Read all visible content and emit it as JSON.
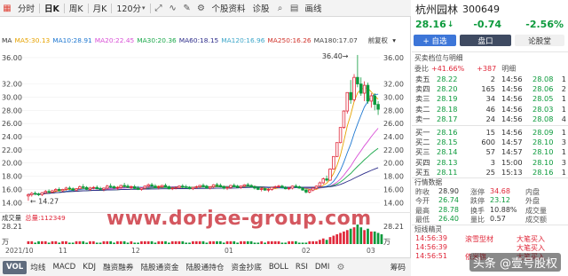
{
  "toolbar": {
    "items": [
      {
        "label": "分时",
        "active": false
      },
      {
        "label": "日K",
        "active": true
      },
      {
        "label": "周K",
        "active": false
      },
      {
        "label": "月K",
        "active": false
      },
      {
        "label": "120分",
        "active": false
      }
    ],
    "extra": [
      "个股资料",
      "诊股",
      "画线"
    ],
    "icons": [
      "layout-icon",
      "fullscreen-icon",
      "line-chart-icon",
      "draw-icon",
      "settings-icon",
      "search-icon",
      "grid-icon"
    ]
  },
  "ma_row": {
    "title": "MA",
    "items": [
      {
        "label": "MA5:30.13",
        "color": "#e6a200"
      },
      {
        "label": "MA10:28.91",
        "color": "#1f78d1"
      },
      {
        "label": "MA20:22.45",
        "color": "#d84fd6"
      },
      {
        "label": "MA30:20.36",
        "color": "#1aa84a"
      },
      {
        "label": "MA60:18.15",
        "color": "#2d2d8a"
      },
      {
        "label": "MA120:16.96",
        "color": "#3da6c9"
      },
      {
        "label": "MA250:16.26",
        "color": "#d0332b"
      },
      {
        "label": "MA180:17.07",
        "color": "#444444"
      }
    ],
    "fq": "前复权"
  },
  "chart_data": {
    "type": "candlestick",
    "y_ticks": [
      "36.00",
      "32.00",
      "30.00",
      "28.00",
      "26.00",
      "24.00",
      "22.00",
      "20.00",
      "18.00",
      "16.00",
      "14.00"
    ],
    "ylim": [
      13.5,
      37.2
    ],
    "high_label": "36.40",
    "low_label": "14.27",
    "dates": [
      "2021/10",
      "11",
      "12",
      "01",
      "02",
      "03"
    ],
    "candles": [
      {
        "o": 15.0,
        "h": 15.4,
        "l": 14.27,
        "c": 15.2
      },
      {
        "o": 15.2,
        "h": 15.6,
        "l": 14.9,
        "c": 15.4
      },
      {
        "o": 15.4,
        "h": 15.7,
        "l": 15.1,
        "c": 15.3
      },
      {
        "o": 15.3,
        "h": 15.5,
        "l": 15.0,
        "c": 15.2
      },
      {
        "o": 15.2,
        "h": 15.6,
        "l": 15.0,
        "c": 15.5
      },
      {
        "o": 15.5,
        "h": 15.9,
        "l": 15.3,
        "c": 15.7
      },
      {
        "o": 15.7,
        "h": 16.0,
        "l": 15.5,
        "c": 15.6
      },
      {
        "o": 15.6,
        "h": 15.9,
        "l": 15.4,
        "c": 15.8
      },
      {
        "o": 15.8,
        "h": 16.2,
        "l": 15.6,
        "c": 16.0
      },
      {
        "o": 16.0,
        "h": 16.3,
        "l": 15.7,
        "c": 15.8
      },
      {
        "o": 15.8,
        "h": 16.1,
        "l": 15.6,
        "c": 16.0
      },
      {
        "o": 16.0,
        "h": 16.4,
        "l": 15.8,
        "c": 16.2
      },
      {
        "o": 16.2,
        "h": 16.5,
        "l": 15.9,
        "c": 16.1
      },
      {
        "o": 16.1,
        "h": 16.3,
        "l": 15.8,
        "c": 15.9
      },
      {
        "o": 15.9,
        "h": 16.2,
        "l": 15.7,
        "c": 16.1
      },
      {
        "o": 16.1,
        "h": 16.6,
        "l": 16.0,
        "c": 16.4
      },
      {
        "o": 16.4,
        "h": 16.8,
        "l": 16.1,
        "c": 16.3
      },
      {
        "o": 16.3,
        "h": 16.5,
        "l": 15.9,
        "c": 16.0
      },
      {
        "o": 16.0,
        "h": 16.4,
        "l": 15.8,
        "c": 16.2
      },
      {
        "o": 16.2,
        "h": 16.5,
        "l": 16.0,
        "c": 16.3
      },
      {
        "o": 16.3,
        "h": 16.6,
        "l": 16.0,
        "c": 16.1
      },
      {
        "o": 16.1,
        "h": 16.4,
        "l": 15.8,
        "c": 16.0
      },
      {
        "o": 16.0,
        "h": 16.3,
        "l": 15.7,
        "c": 16.2
      },
      {
        "o": 16.2,
        "h": 16.7,
        "l": 16.0,
        "c": 16.5
      },
      {
        "o": 16.5,
        "h": 16.9,
        "l": 16.2,
        "c": 16.4
      },
      {
        "o": 16.4,
        "h": 16.6,
        "l": 16.1,
        "c": 16.2
      },
      {
        "o": 16.2,
        "h": 16.5,
        "l": 15.9,
        "c": 16.3
      },
      {
        "o": 16.3,
        "h": 16.7,
        "l": 16.1,
        "c": 16.6
      },
      {
        "o": 16.6,
        "h": 17.0,
        "l": 16.3,
        "c": 16.5
      },
      {
        "o": 16.5,
        "h": 16.8,
        "l": 16.2,
        "c": 16.3
      },
      {
        "o": 16.3,
        "h": 16.6,
        "l": 16.0,
        "c": 16.4
      },
      {
        "o": 16.4,
        "h": 16.7,
        "l": 16.1,
        "c": 16.2
      },
      {
        "o": 16.2,
        "h": 16.5,
        "l": 15.9,
        "c": 16.0
      },
      {
        "o": 16.0,
        "h": 16.3,
        "l": 15.8,
        "c": 16.2
      },
      {
        "o": 16.2,
        "h": 16.6,
        "l": 16.0,
        "c": 16.5
      },
      {
        "o": 16.5,
        "h": 16.9,
        "l": 16.3,
        "c": 16.7
      },
      {
        "o": 16.7,
        "h": 17.0,
        "l": 16.4,
        "c": 16.5
      },
      {
        "o": 16.5,
        "h": 16.8,
        "l": 16.2,
        "c": 16.3
      },
      {
        "o": 16.3,
        "h": 16.6,
        "l": 16.0,
        "c": 16.4
      },
      {
        "o": 16.4,
        "h": 16.7,
        "l": 16.2,
        "c": 16.6
      },
      {
        "o": 16.6,
        "h": 16.9,
        "l": 16.3,
        "c": 16.4
      },
      {
        "o": 16.4,
        "h": 16.6,
        "l": 16.0,
        "c": 16.1
      },
      {
        "o": 16.1,
        "h": 16.4,
        "l": 15.9,
        "c": 16.2
      },
      {
        "o": 16.2,
        "h": 16.5,
        "l": 16.0,
        "c": 16.3
      },
      {
        "o": 16.3,
        "h": 16.6,
        "l": 16.1,
        "c": 16.5
      },
      {
        "o": 16.5,
        "h": 16.8,
        "l": 16.2,
        "c": 16.4
      },
      {
        "o": 16.4,
        "h": 16.7,
        "l": 16.1,
        "c": 16.3
      },
      {
        "o": 16.3,
        "h": 16.5,
        "l": 16.0,
        "c": 16.1
      },
      {
        "o": 16.1,
        "h": 16.4,
        "l": 15.9,
        "c": 16.3
      },
      {
        "o": 16.3,
        "h": 16.6,
        "l": 16.1,
        "c": 16.4
      },
      {
        "o": 16.4,
        "h": 16.7,
        "l": 16.2,
        "c": 16.6
      },
      {
        "o": 16.6,
        "h": 16.9,
        "l": 16.3,
        "c": 16.5
      },
      {
        "o": 16.5,
        "h": 16.7,
        "l": 16.1,
        "c": 16.2
      },
      {
        "o": 16.2,
        "h": 16.5,
        "l": 16.0,
        "c": 16.4
      },
      {
        "o": 16.4,
        "h": 16.8,
        "l": 16.2,
        "c": 16.7
      },
      {
        "o": 16.7,
        "h": 17.0,
        "l": 16.4,
        "c": 16.6
      },
      {
        "o": 16.6,
        "h": 16.9,
        "l": 16.3,
        "c": 16.4
      },
      {
        "o": 16.4,
        "h": 16.6,
        "l": 16.0,
        "c": 16.2
      },
      {
        "o": 16.2,
        "h": 16.5,
        "l": 15.9,
        "c": 16.3
      },
      {
        "o": 16.3,
        "h": 16.7,
        "l": 16.1,
        "c": 16.6
      },
      {
        "o": 16.6,
        "h": 16.9,
        "l": 16.4,
        "c": 16.5
      },
      {
        "o": 16.5,
        "h": 16.7,
        "l": 16.2,
        "c": 16.3
      },
      {
        "o": 16.3,
        "h": 16.6,
        "l": 16.1,
        "c": 16.5
      },
      {
        "o": 16.5,
        "h": 16.8,
        "l": 16.3,
        "c": 16.7
      },
      {
        "o": 16.7,
        "h": 17.0,
        "l": 16.5,
        "c": 16.6
      },
      {
        "o": 16.6,
        "h": 16.8,
        "l": 16.3,
        "c": 16.4
      },
      {
        "o": 16.4,
        "h": 16.6,
        "l": 16.0,
        "c": 16.2
      },
      {
        "o": 16.2,
        "h": 16.4,
        "l": 15.9,
        "c": 16.0
      },
      {
        "o": 16.0,
        "h": 16.3,
        "l": 15.7,
        "c": 16.1
      },
      {
        "o": 16.1,
        "h": 16.3,
        "l": 15.8,
        "c": 15.9
      },
      {
        "o": 15.9,
        "h": 16.2,
        "l": 15.6,
        "c": 16.0
      },
      {
        "o": 16.0,
        "h": 16.4,
        "l": 15.8,
        "c": 16.3
      },
      {
        "o": 16.3,
        "h": 16.6,
        "l": 16.1,
        "c": 16.4
      },
      {
        "o": 16.4,
        "h": 16.7,
        "l": 16.2,
        "c": 16.5
      },
      {
        "o": 16.5,
        "h": 16.7,
        "l": 16.2,
        "c": 16.3
      },
      {
        "o": 16.3,
        "h": 16.5,
        "l": 16.0,
        "c": 16.1
      },
      {
        "o": 16.1,
        "h": 16.4,
        "l": 15.9,
        "c": 16.2
      },
      {
        "o": 16.2,
        "h": 16.6,
        "l": 16.0,
        "c": 16.5
      },
      {
        "o": 16.5,
        "h": 16.8,
        "l": 16.2,
        "c": 16.4
      },
      {
        "o": 16.4,
        "h": 16.6,
        "l": 16.1,
        "c": 16.2
      },
      {
        "o": 16.2,
        "h": 16.4,
        "l": 15.8,
        "c": 15.9
      },
      {
        "o": 15.9,
        "h": 16.1,
        "l": 15.4,
        "c": 15.6
      },
      {
        "o": 15.6,
        "h": 16.0,
        "l": 15.4,
        "c": 15.9
      },
      {
        "o": 15.9,
        "h": 16.3,
        "l": 15.7,
        "c": 16.2
      },
      {
        "o": 16.2,
        "h": 16.6,
        "l": 16.0,
        "c": 16.5
      },
      {
        "o": 16.5,
        "h": 17.2,
        "l": 16.4,
        "c": 17.0
      },
      {
        "o": 17.0,
        "h": 17.8,
        "l": 16.8,
        "c": 17.6
      },
      {
        "o": 17.6,
        "h": 18.1,
        "l": 17.2,
        "c": 17.4
      },
      {
        "o": 17.4,
        "h": 19.2,
        "l": 17.3,
        "c": 19.1
      },
      {
        "o": 19.1,
        "h": 21.0,
        "l": 19.0,
        "c": 21.0
      },
      {
        "o": 21.0,
        "h": 23.1,
        "l": 20.9,
        "c": 23.1
      },
      {
        "o": 23.1,
        "h": 25.4,
        "l": 23.0,
        "c": 25.4
      },
      {
        "o": 25.4,
        "h": 28.0,
        "l": 25.2,
        "c": 27.9
      },
      {
        "o": 27.9,
        "h": 30.7,
        "l": 27.5,
        "c": 30.7
      },
      {
        "o": 30.7,
        "h": 32.6,
        "l": 29.0,
        "c": 29.6
      },
      {
        "o": 29.6,
        "h": 33.5,
        "l": 29.3,
        "c": 33.0
      },
      {
        "o": 33.0,
        "h": 36.4,
        "l": 31.5,
        "c": 32.0
      },
      {
        "o": 32.0,
        "h": 33.0,
        "l": 30.2,
        "c": 30.6
      },
      {
        "o": 30.6,
        "h": 32.4,
        "l": 29.4,
        "c": 31.8
      },
      {
        "o": 31.8,
        "h": 32.2,
        "l": 29.0,
        "c": 29.4
      },
      {
        "o": 29.4,
        "h": 30.6,
        "l": 28.4,
        "c": 30.2
      },
      {
        "o": 30.2,
        "h": 30.6,
        "l": 28.0,
        "c": 28.9
      },
      {
        "o": 28.9,
        "h": 29.4,
        "l": 27.3,
        "c": 28.16
      }
    ],
    "volume_title": "成交量",
    "volume_total": "总量:112349",
    "volume_axis": "28.21",
    "volume_unit": "万",
    "volumes": [
      2,
      2,
      1,
      2,
      2,
      2,
      1,
      2,
      2,
      1,
      2,
      2,
      1,
      1,
      2,
      2,
      2,
      1,
      2,
      2,
      1,
      1,
      2,
      2,
      2,
      1,
      2,
      2,
      2,
      1,
      2,
      1,
      1,
      2,
      2,
      2,
      2,
      1,
      2,
      2,
      2,
      1,
      2,
      2,
      2,
      2,
      1,
      1,
      2,
      2,
      2,
      2,
      1,
      2,
      2,
      2,
      2,
      1,
      2,
      2,
      2,
      1,
      2,
      2,
      2,
      2,
      1,
      1,
      2,
      1,
      2,
      2,
      2,
      2,
      1,
      1,
      2,
      2,
      2,
      1,
      1,
      1,
      2,
      2,
      2,
      3,
      4,
      3,
      5,
      6,
      7,
      8,
      9,
      10,
      11,
      12,
      14,
      12,
      10,
      11,
      9,
      9,
      8,
      7
    ]
  },
  "indicators": {
    "items": [
      "VOL",
      "均线",
      "MACD",
      "KDJ",
      "融资融券",
      "陆股通资金",
      "陆股通持仓",
      "资金抄底",
      "BOLL",
      "RSI",
      "DMI"
    ],
    "active": "VOL",
    "chip": "筹码"
  },
  "watermark": "www.dorjee-group.com",
  "quote": {
    "name": "杭州园林",
    "code": "300649",
    "price": "28.16",
    "arrow": "↓",
    "change": "-0.74",
    "pct": "-2.56%",
    "add_label": "+ 自选",
    "pankou_label": "盘口",
    "lunguge_label": "论股堂",
    "wb_title": "买卖档位与明细",
    "wb_label": "委比",
    "wb_pct": "+41.66%",
    "wb_diff": "+387",
    "detail_label": "明细",
    "asks": [
      {
        "name": "卖五",
        "price": "28.22",
        "vol": "2",
        "t": "14:56",
        "tp": "28.08",
        "tv": "1"
      },
      {
        "name": "卖四",
        "price": "28.20",
        "vol": "165",
        "t": "14:56",
        "tp": "28.06",
        "tv": "2"
      },
      {
        "name": "卖三",
        "price": "28.19",
        "vol": "34",
        "t": "14:56",
        "tp": "28.05",
        "tv": "1"
      },
      {
        "name": "卖二",
        "price": "28.18",
        "vol": "46",
        "t": "14:56",
        "tp": "28.03",
        "tv": "1"
      },
      {
        "name": "卖一",
        "price": "28.17",
        "vol": "24",
        "t": "14:56",
        "tp": "28.08",
        "tv": "4"
      }
    ],
    "bids": [
      {
        "name": "买一",
        "price": "28.16",
        "vol": "15",
        "t": "14:56",
        "tp": "28.09",
        "tv": "1"
      },
      {
        "name": "买二",
        "price": "28.15",
        "vol": "600",
        "t": "14:57",
        "tp": "28.10",
        "tv": "3"
      },
      {
        "name": "买三",
        "price": "28.14",
        "vol": "57",
        "t": "14:57",
        "tp": "28.10",
        "tv": "1"
      },
      {
        "name": "买四",
        "price": "28.13",
        "vol": "3",
        "t": "15:00",
        "tp": "28.10",
        "tv": "3"
      },
      {
        "name": "买五",
        "price": "28.11",
        "vol": "25",
        "t": "15:13",
        "tp": "28.16",
        "tv": "1"
      }
    ],
    "stats_title": "行情数据",
    "stats": [
      {
        "l1": "昨收",
        "v1": "28.90",
        "l2": "涨停",
        "v2": "34.68",
        "l3": "内盘"
      },
      {
        "l1": "今开",
        "v1": "26.74",
        "l2": "跌停",
        "v2": "23.12",
        "l3": "外盘"
      },
      {
        "l1": "最高",
        "v1": "28.78",
        "l2": "换手",
        "v2": "10.88%",
        "l3": "成交量"
      },
      {
        "l1": "最低",
        "v1": "26.40",
        "l2": "量比",
        "v2": "0.57",
        "l3": "成交额"
      }
    ],
    "ticks_title": "短线精灵",
    "ticks": [
      {
        "t": "14:56:39",
        "tag": "滚雪型材",
        "act": "大笔买入"
      },
      {
        "t": "14:56:39",
        "tag": "",
        "act": "大笔买入"
      },
      {
        "t": "14:56:51",
        "tag": "依米旗",
        "act": "大笔买入"
      }
    ],
    "toutiao": "头条 @壹号股权"
  },
  "colors": {
    "up": "#e0283a",
    "down": "#0c9a3c",
    "accent": "#3d76d8"
  }
}
